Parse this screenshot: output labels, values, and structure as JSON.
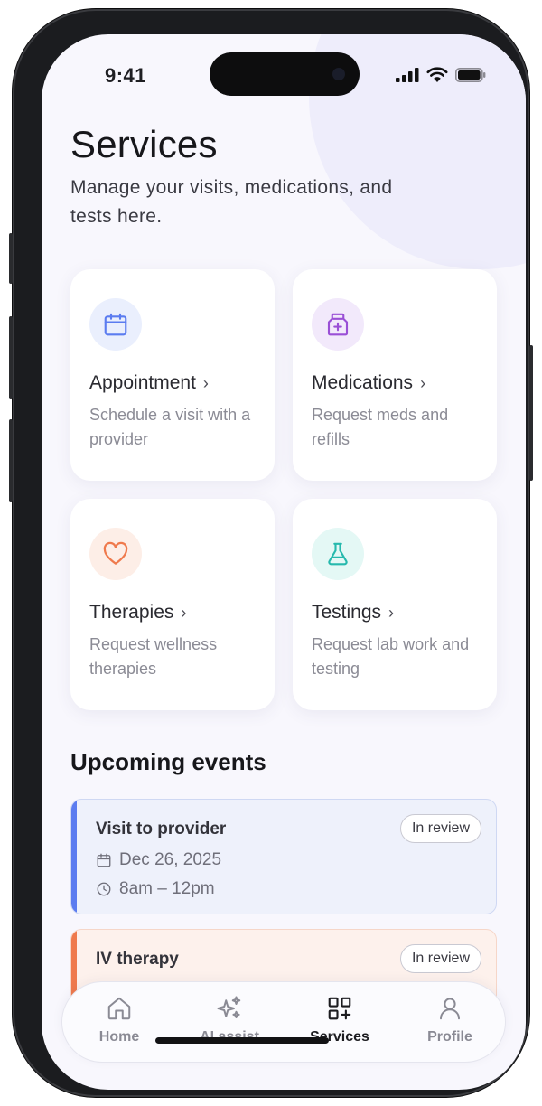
{
  "status_bar": {
    "time": "9:41"
  },
  "header": {
    "title": "Services",
    "subtitle": "Manage your visits, medications, and tests here."
  },
  "services": [
    {
      "title": "Appointment",
      "description": "Schedule a visit with a provider",
      "icon": "calendar-icon",
      "icon_color": "#5b7cf0",
      "icon_bg": "#eaeffd"
    },
    {
      "title": "Medications",
      "description": "Request meds and refills",
      "icon": "medicine-bottle-icon",
      "icon_color": "#9a4fd6",
      "icon_bg": "#f2e9fb"
    },
    {
      "title": "Therapies",
      "description": "Request wellness therapies",
      "icon": "heart-icon",
      "icon_color": "#ef7a4d",
      "icon_bg": "#fdeee7"
    },
    {
      "title": "Testings",
      "description": "Request lab work and testing",
      "icon": "flask-icon",
      "icon_color": "#26b9ad",
      "icon_bg": "#e4f8f5"
    }
  ],
  "upcoming": {
    "title": "Upcoming events",
    "events": [
      {
        "title": "Visit to provider",
        "status": "In review",
        "date": "Dec 26, 2025",
        "time": "8am – 12pm",
        "accent": "#5b7cf0",
        "bg": "#eef1fb"
      },
      {
        "title": "IV therapy",
        "status": "In review",
        "accent": "#ef7a4d",
        "bg": "#fdf1ec"
      }
    ]
  },
  "tab_bar": {
    "tabs": [
      {
        "label": "Home",
        "icon": "home-icon",
        "active": false
      },
      {
        "label": "AI assist",
        "icon": "sparkles-icon",
        "active": false
      },
      {
        "label": "Services",
        "icon": "grid-plus-icon",
        "active": true
      },
      {
        "label": "Profile",
        "icon": "user-icon",
        "active": false
      }
    ]
  }
}
